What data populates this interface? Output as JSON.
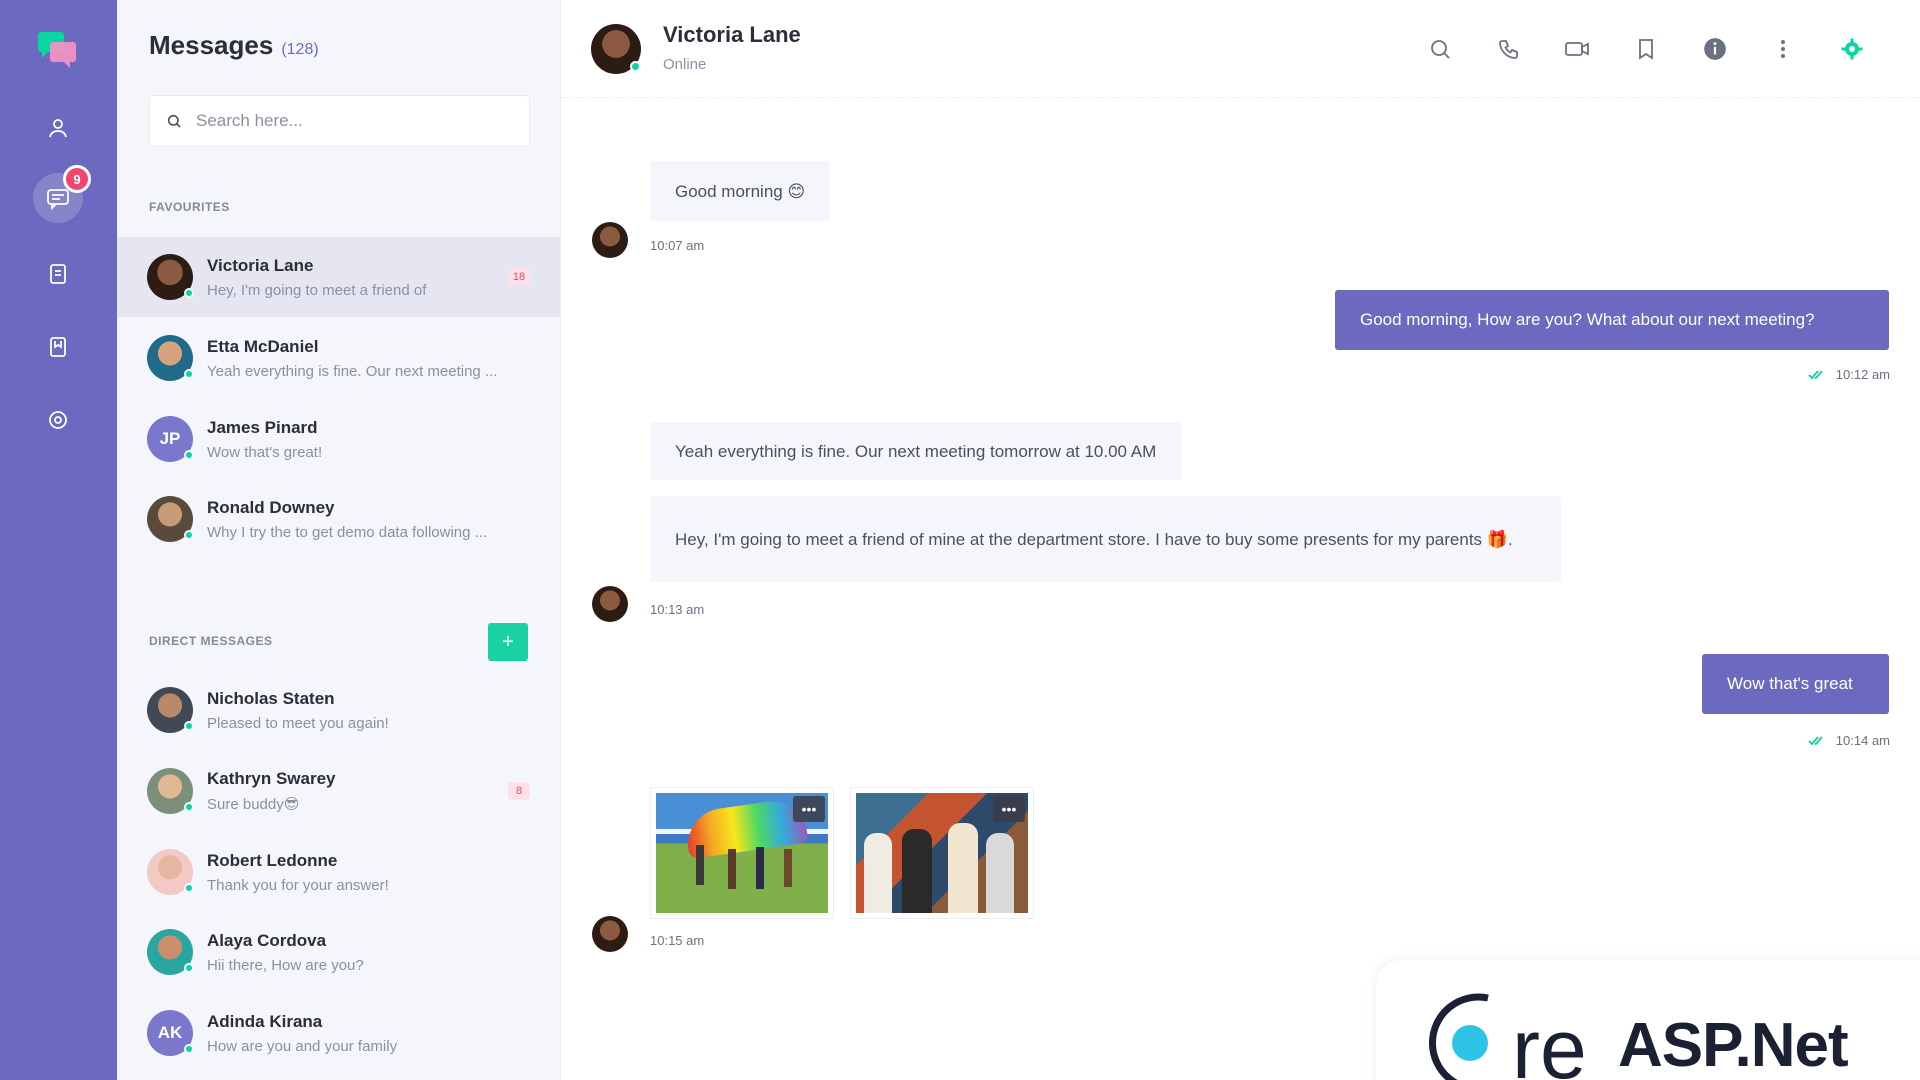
{
  "colors": {
    "rail": "#6c69c0",
    "accent": "#6c69c0",
    "online": "#06d6a0",
    "badge": "#ef476f",
    "add_button": "#19d1a3",
    "panel_bg": "#f5f6fb"
  },
  "rail": {
    "items": [
      {
        "icon": "user-icon"
      },
      {
        "icon": "chat-icon",
        "active": true,
        "badge": "9"
      },
      {
        "icon": "document-icon"
      },
      {
        "icon": "bookmark-icon"
      },
      {
        "icon": "gear-icon"
      }
    ]
  },
  "sidebar": {
    "title": "Messages",
    "count": "(128)",
    "search_placeholder": "Search here...",
    "favourites_label": "FAVOURITES",
    "direct_label": "DIRECT MESSAGES",
    "add_label": "+",
    "favourites": [
      {
        "name": "Victoria Lane",
        "preview": "Hey, I'm going to meet a friend of",
        "unread": "18",
        "active": true,
        "initials": ""
      },
      {
        "name": "Etta McDaniel",
        "preview": "Yeah everything is fine. Our next meeting ...",
        "unread": "",
        "initials": ""
      },
      {
        "name": "James Pinard",
        "preview": "Wow that's great!",
        "unread": "",
        "initials": "JP"
      },
      {
        "name": "Ronald Downey",
        "preview": "Why I try the to get demo data following ...",
        "unread": "",
        "initials": ""
      }
    ],
    "direct": [
      {
        "name": "Nicholas Staten",
        "preview": "Pleased to meet you again!",
        "unread": "",
        "initials": ""
      },
      {
        "name": "Kathryn Swarey",
        "preview": "Sure buddy😎",
        "unread": "8",
        "initials": ""
      },
      {
        "name": "Robert Ledonne",
        "preview": "Thank you for your answer!",
        "unread": "",
        "initials": ""
      },
      {
        "name": "Alaya Cordova",
        "preview": "Hii there, How are you?",
        "unread": "",
        "initials": ""
      },
      {
        "name": "Adinda Kirana",
        "preview": "How are you and your family",
        "unread": "",
        "initials": "AK"
      }
    ]
  },
  "header": {
    "name": "Victoria Lane",
    "status": "Online",
    "icons": [
      "search-icon",
      "phone-icon",
      "video-icon",
      "bookmark-icon",
      "info-icon",
      "more-vertical-icon",
      "gear-icon"
    ]
  },
  "messages": {
    "m1": "Good morning 😊",
    "t1": "10:07 am",
    "m2": "Good morning, How are you? What about our next meeting?",
    "t2": "10:12 am",
    "m3": "Yeah everything is fine. Our next meeting tomorrow at 10.00 AM",
    "m4": "Hey, I'm going to meet a friend of mine at the department store. I have to buy some presents for my parents 🎁.",
    "t3": "10:13 am",
    "m5": "Wow that's great",
    "t4": "10:14 am",
    "t5": "10:15 am",
    "photo_more": "•••"
  },
  "watermark": {
    "brand_letters": "re",
    "brand_name": "ASP.Net"
  }
}
